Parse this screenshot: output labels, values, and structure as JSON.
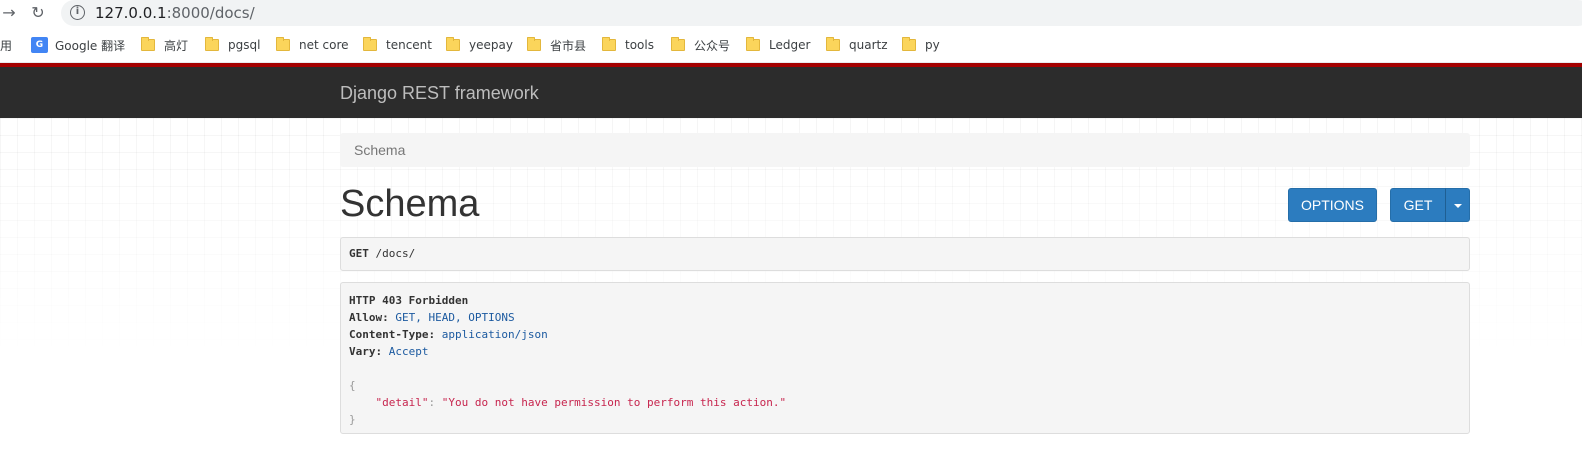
{
  "browser": {
    "url_host": "127.0.0.1",
    "url_rest": ":8000/docs/",
    "bookmarks": [
      {
        "label": "应用",
        "type": "apps"
      },
      {
        "label": "Google 翻译",
        "type": "gtrans"
      },
      {
        "label": "高灯",
        "type": "folder"
      },
      {
        "label": "pgsql",
        "type": "folder"
      },
      {
        "label": "net core",
        "type": "folder"
      },
      {
        "label": "tencent",
        "type": "folder"
      },
      {
        "label": "yeepay",
        "type": "folder"
      },
      {
        "label": "省市县",
        "type": "folder"
      },
      {
        "label": "tools",
        "type": "folder"
      },
      {
        "label": "公众号",
        "type": "folder"
      },
      {
        "label": "Ledger",
        "type": "folder"
      },
      {
        "label": "quartz",
        "type": "folder"
      },
      {
        "label": "py",
        "type": "folder"
      }
    ]
  },
  "navbar": {
    "brand": "Django REST framework"
  },
  "breadcrumb": {
    "current": "Schema"
  },
  "page": {
    "title": "Schema",
    "options_label": "OPTIONS",
    "get_label": "GET"
  },
  "request": {
    "method": "GET",
    "path": "/docs/"
  },
  "response": {
    "status": "HTTP 403 Forbidden",
    "headers": [
      {
        "name": "Allow",
        "value": "GET, HEAD, OPTIONS"
      },
      {
        "name": "Content-Type",
        "value": "application/json"
      },
      {
        "name": "Vary",
        "value": "Accept"
      }
    ],
    "body_open": "{",
    "body_key": "\"detail\"",
    "body_value": "\"You do not have permission to perform this action.\"",
    "body_close": "}"
  },
  "colors": {
    "navbar": "#2c2c2c",
    "accent_strip": "#a30000",
    "button": "#2c7cbf"
  }
}
